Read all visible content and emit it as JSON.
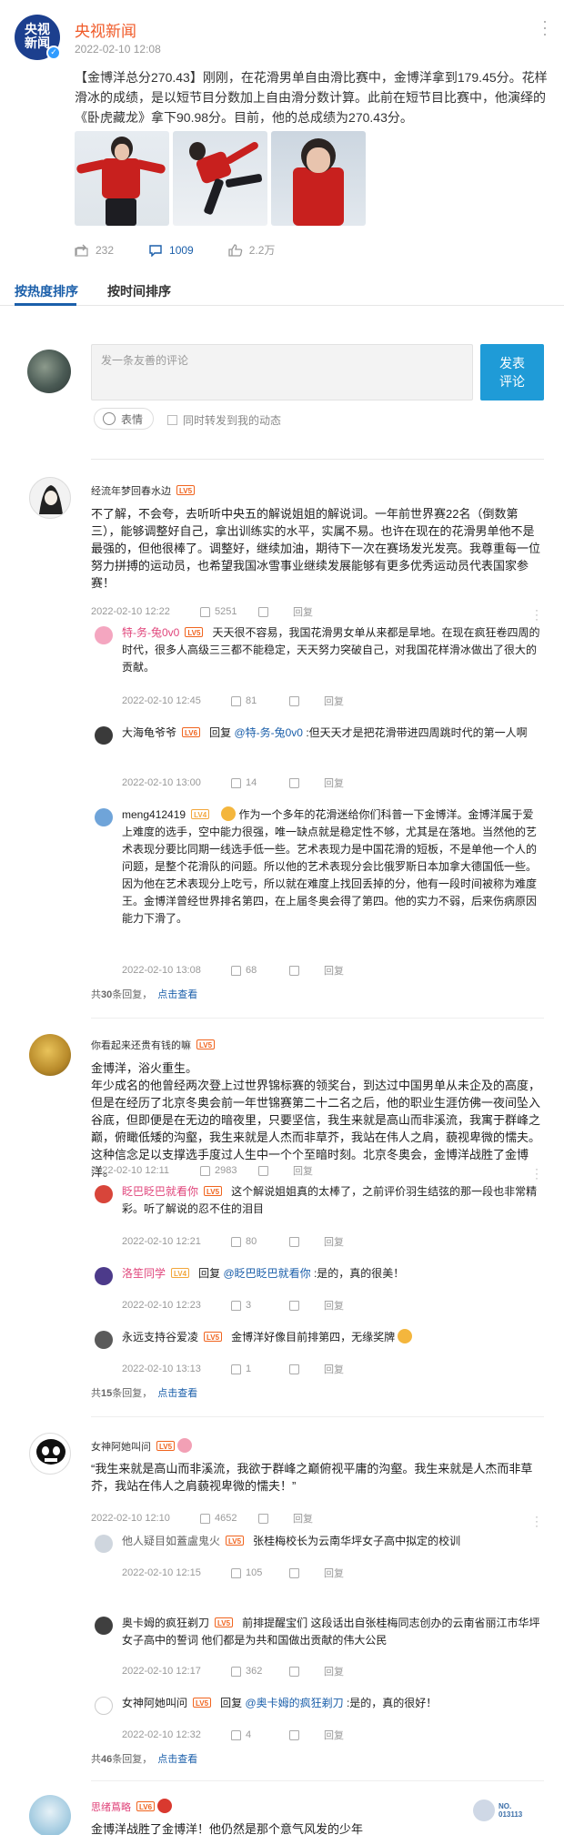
{
  "post": {
    "author": "央视新闻",
    "avatar_text": [
      "央视",
      "新闻"
    ],
    "time": "2022-02-10 12:08",
    "text": "【金博洋总分270.43】刚刚，在花滑男单自由滑比赛中，金博洋拿到179.45分。花样滑冰的成绩，是以短节目分数加上自由滑分数计算。此前在短节目比赛中，他演绎的《卧虎藏龙》拿下90.98分。目前，他的总成绩为270.43分。",
    "reposts": "232",
    "comments": "1009",
    "likes": "2.2万"
  },
  "tabs": [
    "按热度排序",
    "按时间排序"
  ],
  "comment_box": {
    "placeholder": "发一条友善的评论",
    "submit": "发表\n评论",
    "emoji": "表情",
    "repost": "同时转发到我的动态"
  },
  "comments": [
    {
      "user": "经流年梦回春水边",
      "level": "LV5",
      "text": "不了解，不会夸，去听听中央五的解说姐姐的解说词。一年前世界赛22名（倒数第三），能够调整好自己，拿出训练实的水平，实属不易。也许在现在的花滑男单他不是最强的，但他很棒了。调整好，继续加油，期待下一次在赛场发光发亮。我尊重每一位努力拼搏的运动员，也希望我国冰雪事业继续发展能够有更多优秀运动员代表国家参赛！",
      "time": "2022-02-10 12:22",
      "likes": "5251",
      "reply": "回复",
      "replies": [
        {
          "user": "特-务-兔0v0",
          "level": "LV5",
          "text": "天天很不容易，我国花滑男女单从来都是旱地。在现在疯狂卷四周的时代，很多人高级三三都不能稳定，天天努力突破自己，对我国花样滑冰做出了很大的贡献。",
          "time": "2022-02-10 12:45",
          "likes": "81",
          "reply": "回复"
        },
        {
          "user": "大海龟爷爷",
          "level": "LV6",
          "prefix": "回复 ",
          "mention": "@特-务-兔0v0",
          "text": " :但天天才是把花滑带进四周跳时代的第一人啊",
          "time": "2022-02-10 13:00",
          "likes": "14",
          "reply": "回复"
        },
        {
          "user": "meng412419",
          "level": "LV4",
          "text": "作为一个多年的花滑迷给你们科普一下金博洋。金博洋属于爱上难度的选手，空中能力很强，唯一缺点就是稳定性不够，尤其是在落地。当然他的艺术表现分要比同期一线选手低一些。艺术表现力是中国花滑的短板，不是单他一个人的问题，是整个花滑队的问题。所以他的艺术表现分会比俄罗斯日本加拿大德国低一些。因为他在艺术表现分上吃亏，所以就在难度上找回丢掉的分，他有一段时间被称为难度王。金博洋曾经世界排名第四，在上届冬奥会得了第四。他的实力不弱，后来伤病原因能力下滑了。",
          "time": "2022-02-10 13:08",
          "likes": "68",
          "reply": "回复"
        }
      ],
      "more": {
        "prefix": "共",
        "count": "30",
        "suffix": "条回复，",
        "link": "点击查看"
      }
    },
    {
      "user": "你看起来还贵有钱的嘛",
      "level": "LV5",
      "text": "金博洋，浴火重生。\n年少成名的他曾经两次登上过世界锦标赛的领奖台，到达过中国男单从未企及的高度，但是在经历了北京冬奥会前一年世锦赛第二十二名之后，他的职业生涯仿佛一夜间坠入谷底，但即便是在无边的暗夜里，只要坚信，我生来就是高山而非溪流，我寓于群峰之巅，俯瞰低矮的沟壑，我生来就是人杰而非草芥，我站在伟人之肩，藐视卑微的懦夫。这种信念足以支撑选手度过人生中一个个至暗时刻。北京冬奥会，金博洋战胜了金博洋。",
      "time": "2022-02-10 12:11",
      "likes": "2983",
      "reply": "回复",
      "replies": [
        {
          "user": "眨巴眨巴就看你",
          "level": "LV5",
          "text": "这个解说姐姐真的太棒了，之前评价羽生结弦的那一段也非常精彩。听了解说的忍不住的泪目",
          "time": "2022-02-10 12:21",
          "likes": "80",
          "reply": "回复"
        },
        {
          "user": "洛笙同学",
          "level": "LV4",
          "prefix": "回复 ",
          "mention": "@眨巴眨巴就看你",
          "text": " :是的，真的很美！",
          "time": "2022-02-10 12:23",
          "likes": "3",
          "reply": "回复"
        },
        {
          "user": "永远支持谷爱凌",
          "level": "LV5",
          "text": "金博洋好像目前排第四，无缘奖牌",
          "time": "2022-02-10 13:13",
          "likes": "1",
          "reply": "回复"
        }
      ],
      "more": {
        "prefix": "共",
        "count": "15",
        "suffix": "条回复，",
        "link": "点击查看"
      }
    },
    {
      "user": "女神阿她叫问",
      "level": "LV5",
      "text": "“我生来就是高山而非溪流，我欲于群峰之巅俯视平庸的沟壑。我生来就是人杰而非草芥，我站在伟人之肩藐视卑微的懦夫！”",
      "time": "2022-02-10 12:10",
      "likes": "4652",
      "reply": "回复",
      "replies": [
        {
          "user": "他人疑目如蓋盧鬼火",
          "level": "LV5",
          "text": "张桂梅校长为云南华坪女子高中拟定的校训",
          "time": "2022-02-10 12:15",
          "likes": "105",
          "reply": "回复"
        },
        {
          "user": "奥卡姆的疯狂剃刀",
          "level": "LV5",
          "text": "前排提醒宝们 这段话出自张桂梅同志创办的云南省丽江市华坪女子高中的誓词 他们都是为共和国做出贡献的伟大公民",
          "time": "2022-02-10 12:17",
          "likes": "362",
          "reply": "回复"
        },
        {
          "user": "女神阿她叫问",
          "level": "LV5",
          "prefix": "回复 ",
          "mention": "@奥卡姆的疯狂剃刀",
          "text": " :是的，真的很好！",
          "time": "2022-02-10 12:32",
          "likes": "4",
          "reply": "回复"
        }
      ],
      "more": {
        "prefix": "共",
        "count": "46",
        "suffix": "条回复，",
        "link": "点击查看"
      }
    },
    {
      "user": "思绪蔦略",
      "level": "LV6",
      "text": "金博洋战胜了金博洋！他仍然是那个意气风发的少年",
      "badge": "NO.\n013113"
    }
  ]
}
